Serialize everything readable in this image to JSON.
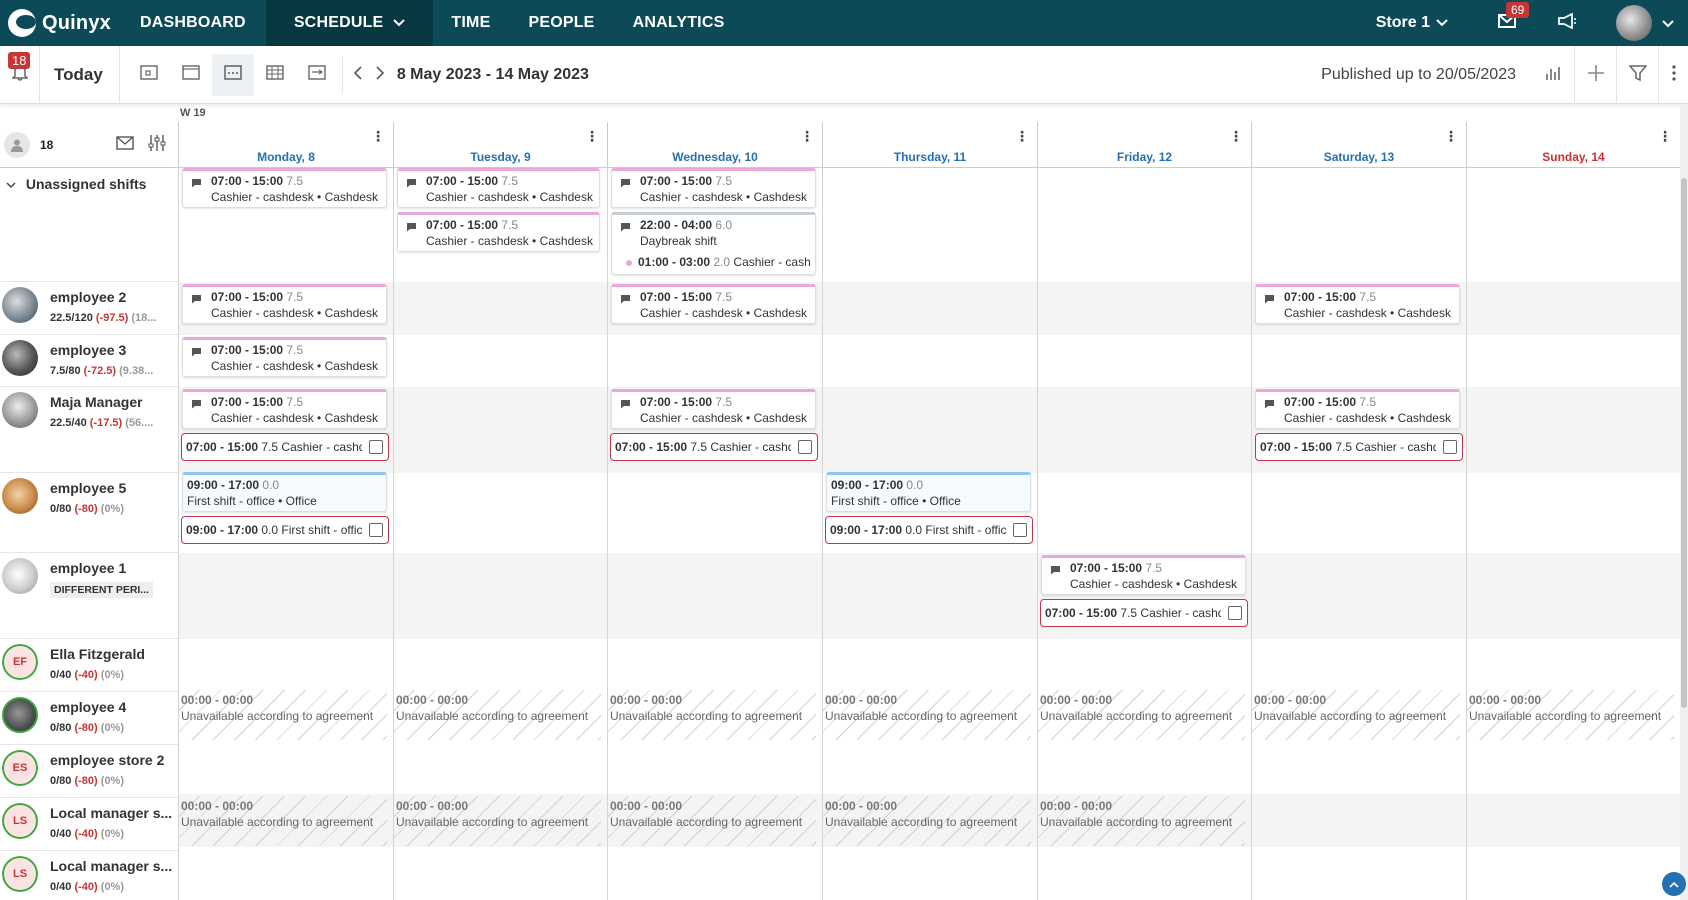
{
  "nav": {
    "logo": "Quinyx",
    "items": [
      "DASHBOARD",
      "SCHEDULE",
      "TIME",
      "PEOPLE",
      "ANALYTICS"
    ],
    "active": "SCHEDULE",
    "store": "Store 1",
    "mail_badge": "69"
  },
  "toolbar": {
    "bell_badge": "18",
    "today": "Today",
    "date_range": "8 May 2023 - 14 May 2023",
    "published": "Published up to 20/05/2023"
  },
  "schedule": {
    "week_label": "W 19",
    "employee_count": "18",
    "days": [
      "Monday, 8",
      "Tuesday, 9",
      "Wednesday, 10",
      "Thursday, 11",
      "Friday, 12",
      "Saturday, 13",
      "Sunday, 14"
    ],
    "unassigned_label": "Unassigned shifts",
    "employees": [
      {
        "name": "employee 2",
        "stat_a": "22.5/120",
        "stat_b": "(-97.5)",
        "stat_c": "(18..."
      },
      {
        "name": "employee 3",
        "stat_a": "7.5/80",
        "stat_b": "(-72.5)",
        "stat_c": "(9.38..."
      },
      {
        "name": "Maja Manager",
        "stat_a": "22.5/40",
        "stat_b": "(-17.5)",
        "stat_c": "(56...."
      },
      {
        "name": "employee 5",
        "stat_a": "0/80",
        "stat_b": "(-80)",
        "stat_c": "(0%)"
      },
      {
        "name": "employee 1",
        "tag": "DIFFERENT PERI..."
      },
      {
        "name": "Ella Fitzgerald",
        "initials": "EF",
        "stat_a": "0/40",
        "stat_b": "(-40)",
        "stat_c": "(0%)"
      },
      {
        "name": "employee 4",
        "stat_a": "0/80",
        "stat_b": "(-80)",
        "stat_c": "(0%)"
      },
      {
        "name": "employee store 2",
        "initials": "ES",
        "stat_a": "0/80",
        "stat_b": "(-80)",
        "stat_c": "(0%)"
      },
      {
        "name": "Local manager s...",
        "initials": "LS",
        "stat_a": "0/40",
        "stat_b": "(-40)",
        "stat_c": "(0%)"
      },
      {
        "name": "Local manager s...",
        "initials": "LS",
        "stat_a": "0/40",
        "stat_b": "(-40)",
        "stat_c": "(0%)"
      }
    ],
    "shift_time": "07:00 - 15:00",
    "shift_hours": "7.5",
    "shift_desc": "Cashier - cashdesk • Cashdesk",
    "night_time": "22:00 - 04:00",
    "night_hours": "6.0",
    "night_desc": "Daybreak shift",
    "night_sub_time": "01:00 - 03:00",
    "night_sub_hours": "2.0",
    "night_sub_desc": "Cashier - cash",
    "punch_cashier": "7.5 Cashier - cashdesk",
    "office_time": "09:00 - 17:00",
    "office_hours": "0.0",
    "office_desc": "First shift - office • Office",
    "punch_office": "0.0 First shift - office",
    "unavail_time": "00:00 - 00:00",
    "unavail_desc": "Unavailable according to agreement"
  }
}
